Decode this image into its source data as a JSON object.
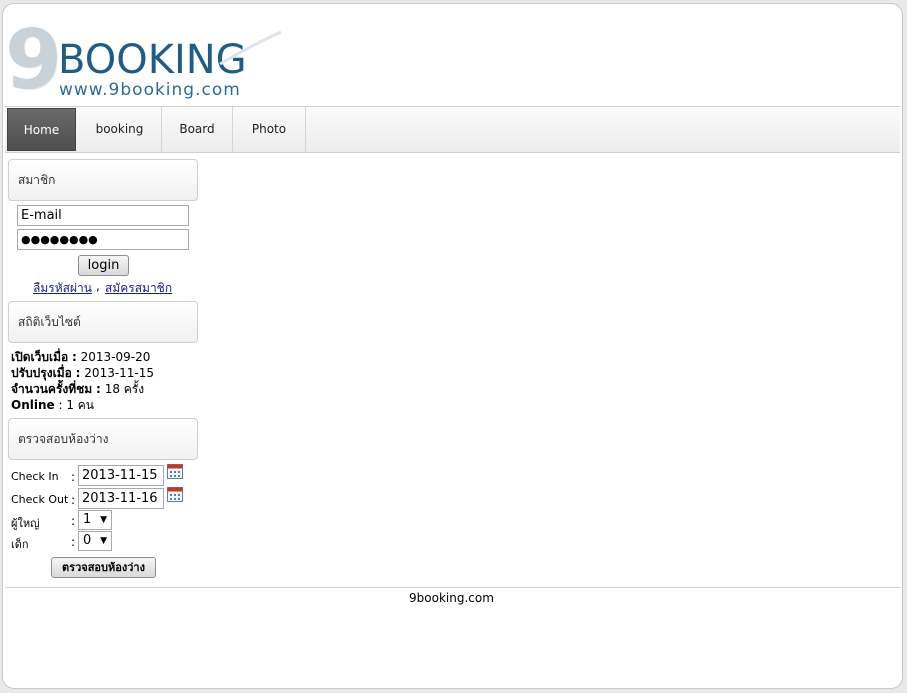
{
  "logo": {
    "numeral": "9",
    "brand": "BOOKING",
    "url": "www.9booking.com"
  },
  "nav": [
    {
      "label": "Home",
      "active": true
    },
    {
      "label": "booking"
    },
    {
      "label": "Board"
    },
    {
      "label": "Photo"
    }
  ],
  "member": {
    "title": "สมาชิก",
    "email_value": "E-mail",
    "password_value": "●●●●●●●●",
    "login_label": "login",
    "forgot_label": "ลืมรหัสผ่าน",
    "separator": ",",
    "register_label": "สมัครสมาชิก"
  },
  "stats": {
    "title": "สถิติเว็บไซต์",
    "opened_label": "เปิดเว็บเมื่อ",
    "opened_value": "2013-09-20",
    "updated_label": "ปรับปรุงเมื่อ",
    "updated_value": "2013-11-15",
    "views_label": "จำนวนครั้งที่ชม",
    "views_value": "18 ครั้ง",
    "online_label": "Online",
    "online_value": "1 คน"
  },
  "availability": {
    "title": "ตรวจสอบห้องว่าง",
    "checkin_label": "Check In",
    "checkin_value": "2013-11-15",
    "checkout_label": "Check Out",
    "checkout_value": "2013-11-16",
    "adults_label": "ผู้ใหญ่",
    "adults_value": "1",
    "children_label": "เด็ก",
    "children_value": "0",
    "colon": ":",
    "submit_label": "ตรวจสอบห้องว่าง"
  },
  "footer": {
    "text": "9booking.com"
  },
  "colors": {
    "brand_blue": "#1f5d86",
    "nav_active": "#555555"
  }
}
